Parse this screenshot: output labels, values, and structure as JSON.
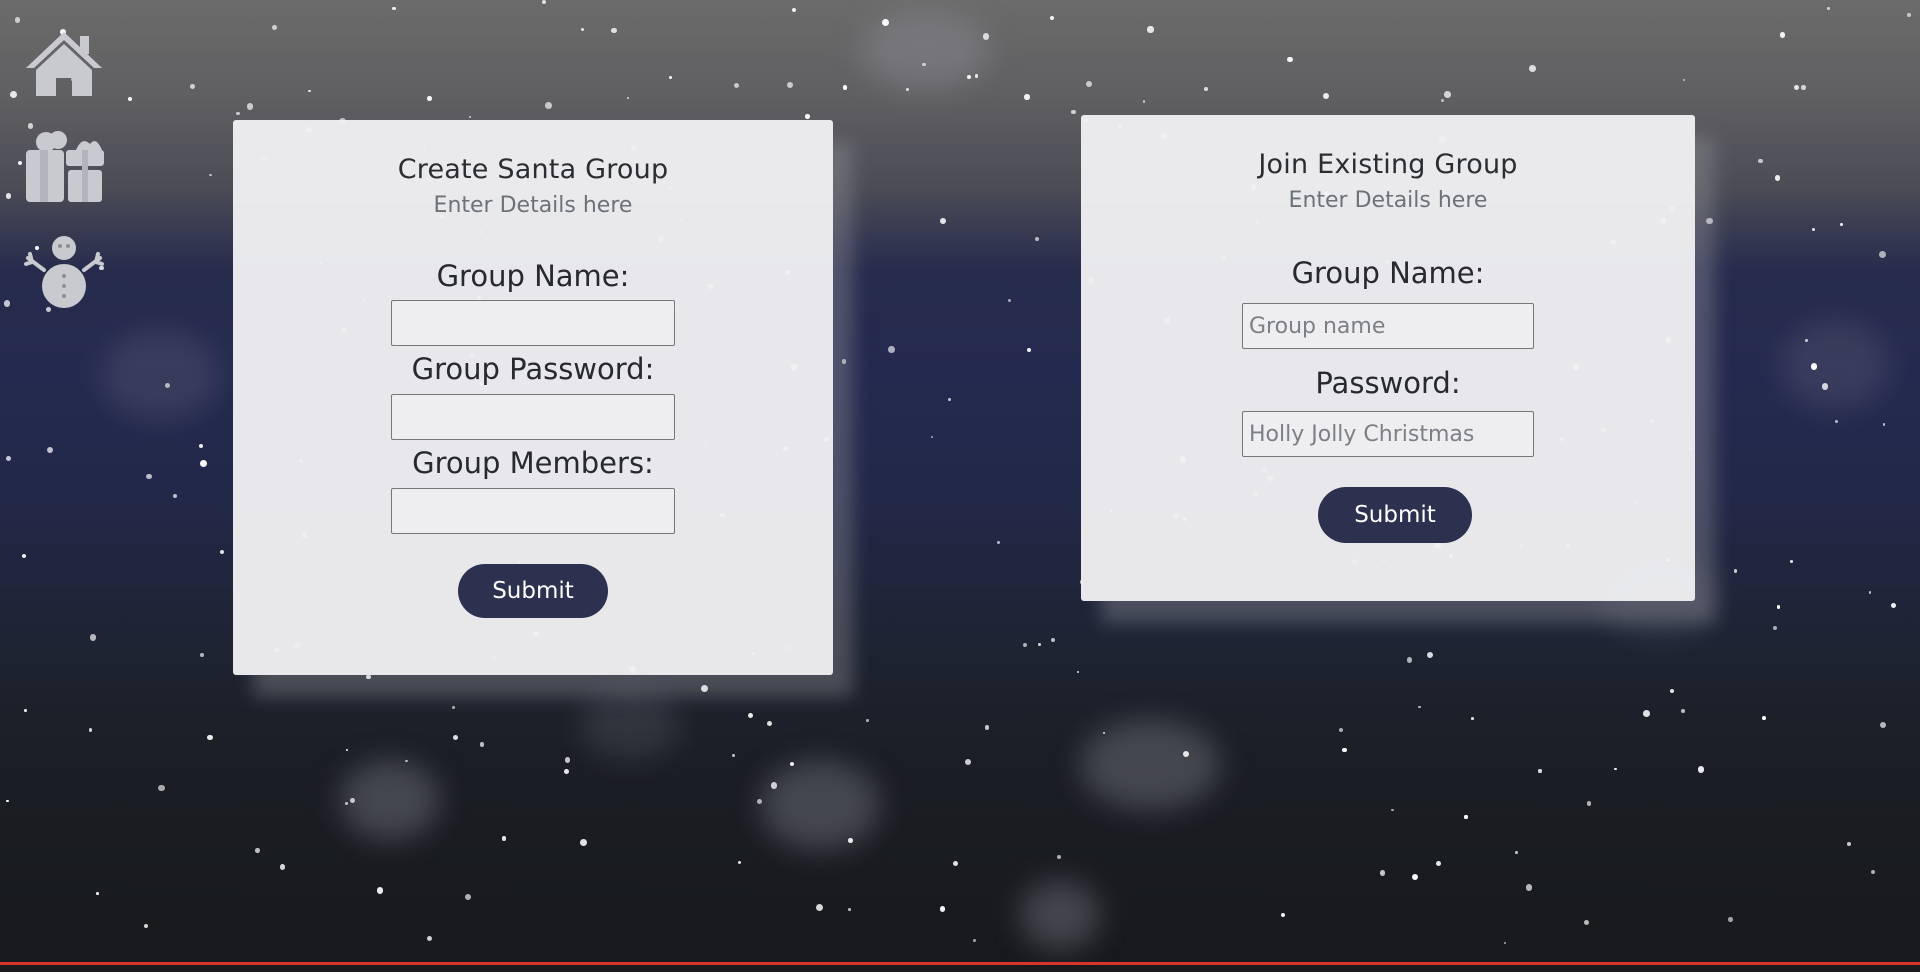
{
  "nav": {
    "items": [
      {
        "icon": "home-icon"
      },
      {
        "icon": "gift-icon"
      },
      {
        "icon": "snowman-icon"
      }
    ]
  },
  "create_group": {
    "title": "Create Santa Group",
    "subtitle": "Enter Details here",
    "name_label": "Group Name:",
    "name_value": "",
    "password_label": "Group Password:",
    "password_value": "",
    "members_label": "Group Members:",
    "members_value": "",
    "submit_label": "Submit"
  },
  "join_group": {
    "title": "Join Existing Group",
    "subtitle": "Enter Details here",
    "name_label": "Group Name:",
    "name_placeholder": "Group name",
    "password_label": "Password:",
    "password_placeholder": "Holly Jolly Christmas",
    "submit_label": "Submit"
  },
  "colors": {
    "button": "#2c3150",
    "card": "#f0f0f3",
    "bottom_accent": "#d9342b",
    "icon": "#c9cad0"
  }
}
